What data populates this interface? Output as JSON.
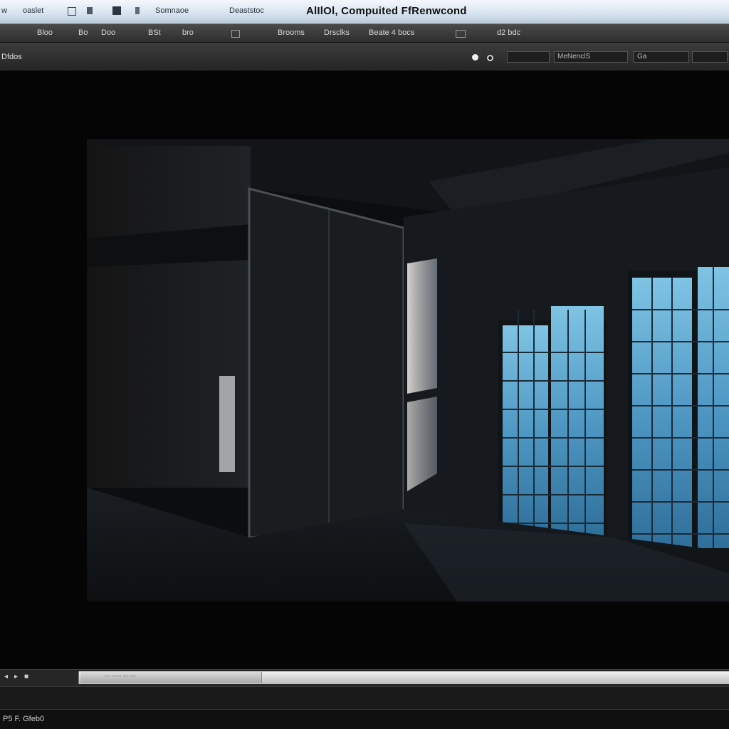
{
  "window": {
    "title": "AlIlOl, Compuited FfRenwcond",
    "top_items": [
      "w",
      "oaslet",
      "",
      "Somnaoe",
      "Deaststoc"
    ]
  },
  "menu": {
    "items": [
      "Bloo",
      "Bo",
      "Doo",
      "BSt",
      "bro",
      "Brooms",
      "Drsclks",
      "Beate 4 bocs",
      "d2 bdc"
    ]
  },
  "options": {
    "label": "Dfdos",
    "field_a": "",
    "field_b": "MeNenclS",
    "field_c": "Ga"
  },
  "canvas": {
    "description_icon": "photo-render-icon"
  },
  "timeline": {
    "controls": [
      "rewind-icon",
      "play-icon",
      "stop-icon"
    ],
    "clip_label": "--- ----- --- ---"
  },
  "status": {
    "text": "P5 F. Gfeb0"
  },
  "colors": {
    "titlebar": "#d6e2ee",
    "panel": "#2e2e2e",
    "canvas_bg": "#050505",
    "window_glow": "#6fb6d8"
  }
}
